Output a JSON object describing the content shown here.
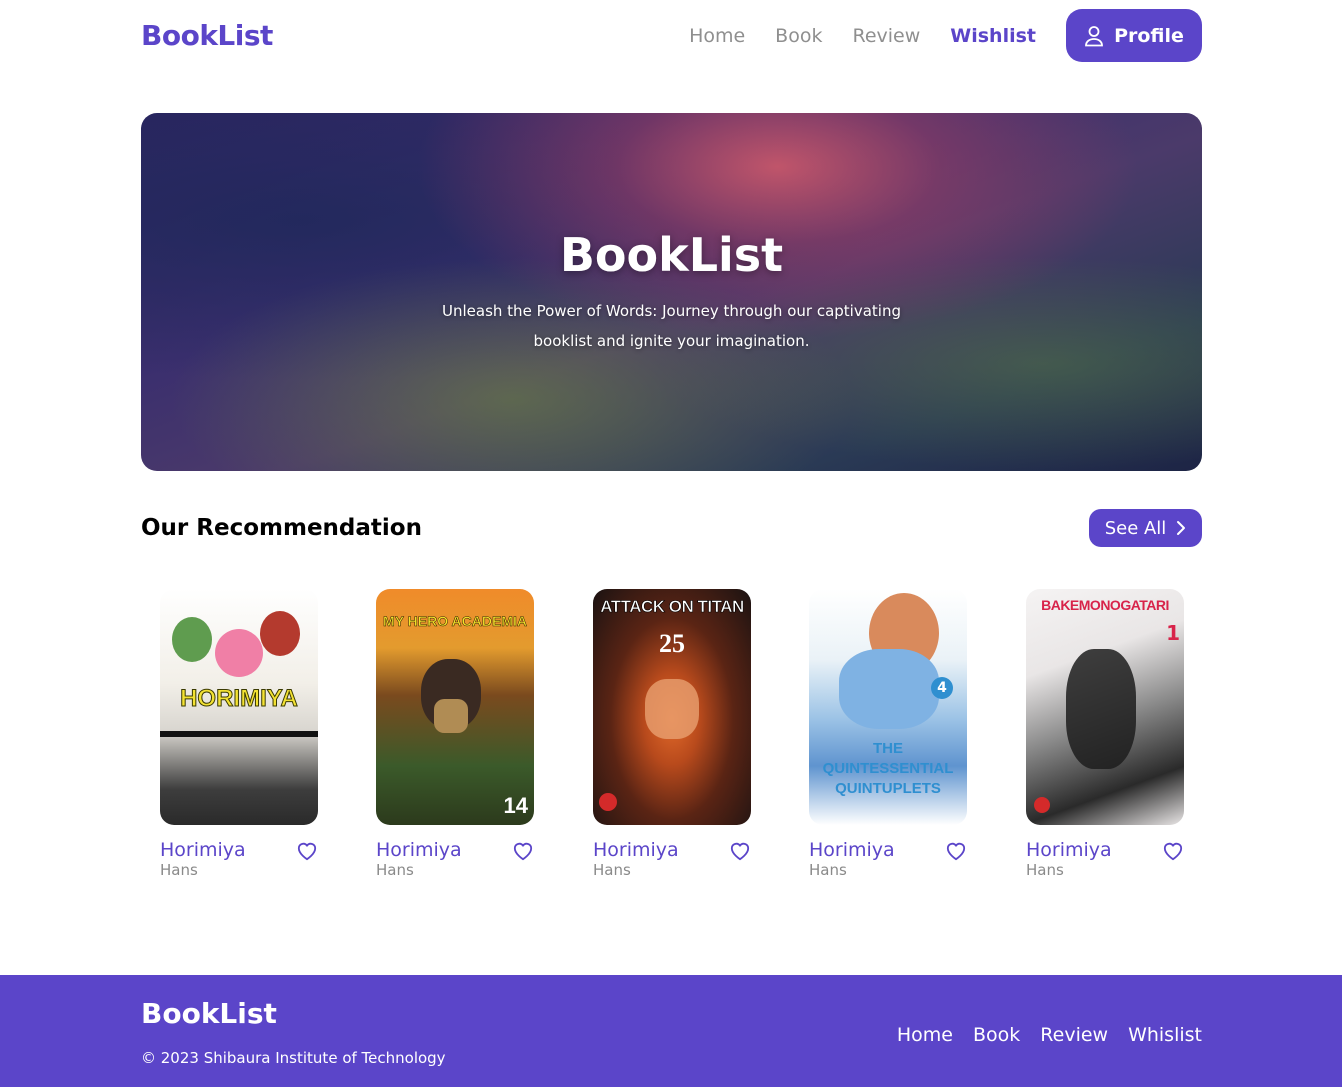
{
  "header": {
    "logo": "BookList",
    "nav": [
      "Home",
      "Book",
      "Review",
      "Wishlist"
    ],
    "active_nav": "Wishlist",
    "profile_label": "Profile"
  },
  "hero": {
    "title": "BookList",
    "subtitle": "Unleash the Power of Words: Journey through our captivating booklist and ignite your imagination."
  },
  "recommendation": {
    "title": "Our Recommendation",
    "see_all_label": "See All",
    "books": [
      {
        "title": "Horimiya",
        "author": "Hans",
        "cover_text": "HORIMIYA",
        "cover_colors": [
          "#d9d6d0",
          "#3d3d3d"
        ]
      },
      {
        "title": "Horimiya",
        "author": "Hans",
        "cover_text": "MY HERO ACADEMIA",
        "cover_colors": [
          "#e39b2e",
          "#3b5a2a"
        ]
      },
      {
        "title": "Horimiya",
        "author": "Hans",
        "cover_text": "ATTACK ON TITAN",
        "cover_colors": [
          "#1a1212",
          "#c0521e"
        ]
      },
      {
        "title": "Horimiya",
        "author": "Hans",
        "cover_text": "THE QUINTESSENTIAL QUINTUPLETS",
        "cover_colors": [
          "#eaf2f7",
          "#5f94cf"
        ]
      },
      {
        "title": "Horimiya",
        "author": "Hans",
        "cover_text": "BAKEMONOGATARI",
        "cover_colors": [
          "#e9e6e6",
          "#2a2a2a"
        ]
      }
    ]
  },
  "footer": {
    "logo": "BookList",
    "copyright": "© 2023 Shibaura Institute of Technology",
    "nav": [
      "Home",
      "Book",
      "Review",
      "Whislist"
    ]
  },
  "colors": {
    "accent": "#5b45c9",
    "muted": "#8f8f8f"
  }
}
